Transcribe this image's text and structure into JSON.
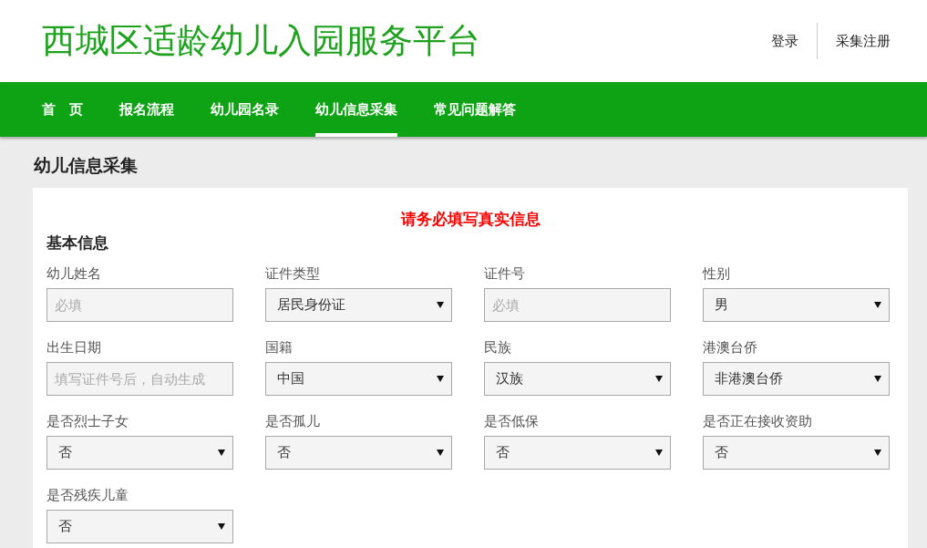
{
  "site_title": "西城区适龄幼儿入园服务平台",
  "header_links": [
    {
      "label": "登录"
    },
    {
      "label": "采集注册"
    }
  ],
  "nav": [
    {
      "label": "首　页",
      "selected": false
    },
    {
      "label": "报名流程",
      "selected": false
    },
    {
      "label": "幼儿园名录",
      "selected": false
    },
    {
      "label": "幼儿信息采集",
      "selected": true
    },
    {
      "label": "常见问题解答",
      "selected": false
    }
  ],
  "page_title": "幼儿信息采集",
  "notice": "请务必填写真实信息",
  "section_title": "基本信息",
  "fields": [
    {
      "label": "幼儿姓名",
      "kind": "text",
      "placeholder": "必填"
    },
    {
      "label": "证件类型",
      "kind": "select",
      "value": "居民身份证"
    },
    {
      "label": "证件号",
      "kind": "text",
      "placeholder": "必填"
    },
    {
      "label": "性别",
      "kind": "select",
      "value": "男"
    },
    {
      "label": "出生日期",
      "kind": "text",
      "placeholder": "填写证件号后，自动生成"
    },
    {
      "label": "国籍",
      "kind": "select",
      "value": "中国"
    },
    {
      "label": "民族",
      "kind": "select",
      "value": "汉族"
    },
    {
      "label": "港澳台侨",
      "kind": "select",
      "value": "非港澳台侨"
    },
    {
      "label": "是否烈士子女",
      "kind": "select",
      "value": "否"
    },
    {
      "label": "是否孤儿",
      "kind": "select",
      "value": "否"
    },
    {
      "label": "是否低保",
      "kind": "select",
      "value": "否"
    },
    {
      "label": "是否正在接收资助",
      "kind": "select",
      "value": "否"
    },
    {
      "label": "是否残疾儿童",
      "kind": "select",
      "value": "否"
    }
  ]
}
